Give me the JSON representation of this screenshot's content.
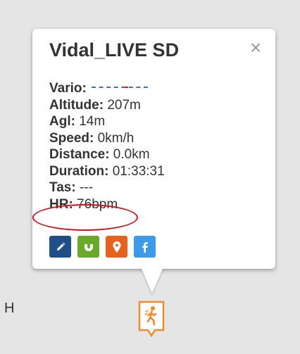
{
  "popup": {
    "title": "Vidal_LIVE SD",
    "close_symbol": "×",
    "stats": [
      {
        "label": "Vario:",
        "value": ""
      },
      {
        "label": "Altitude:",
        "value": " 207m"
      },
      {
        "label": "Agl:",
        "value": " 14m"
      },
      {
        "label": "Speed:",
        "value": " 0km/h"
      },
      {
        "label": "Distance:",
        "value": " 0.0km"
      },
      {
        "label": "Duration:",
        "value": " 01:33:31"
      },
      {
        "label": "Tas:",
        "value": " ---"
      },
      {
        "label": "HR:",
        "value": " 76bpm"
      }
    ],
    "actions": [
      {
        "name": "edit-button",
        "icon": "pencil-icon",
        "color": "#1f4f86"
      },
      {
        "name": "magnet-button",
        "icon": "magnet-icon",
        "color": "#6aaa2a"
      },
      {
        "name": "location-button",
        "icon": "map-pin-icon",
        "color": "#e8621f"
      },
      {
        "name": "facebook-button",
        "icon": "facebook-icon",
        "color": "#3d9ae8"
      }
    ]
  },
  "map": {
    "side_letter": "H",
    "marker_icon": "walker-icon",
    "marker_color": "#f08a2e"
  },
  "highlight": {
    "target": "HR",
    "color": "#d0101c"
  }
}
